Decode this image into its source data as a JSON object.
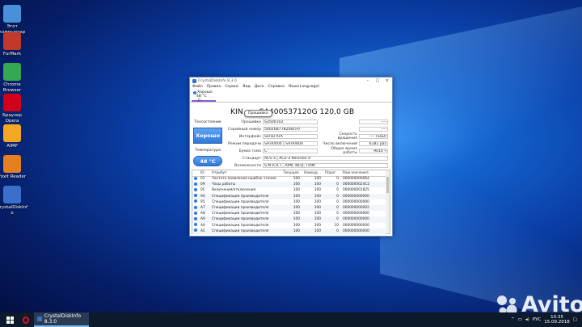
{
  "desktop": {
    "icons": [
      {
        "label": "Этот компьютер",
        "color": "#4a90d9"
      },
      {
        "label": "FurMark",
        "color": "#c0392b"
      },
      {
        "label": "Chrome Browser",
        "color": "#34a853"
      },
      {
        "label": "Браузер Opera",
        "color": "#d0021b"
      },
      {
        "label": "AIMP",
        "color": "#f5a623"
      },
      {
        "label": "Foxit Reader",
        "color": "#e67e22"
      },
      {
        "label": "CrystalDiskInf o",
        "color": "#3b6fc9"
      }
    ]
  },
  "window": {
    "title": "CrystalDiskInfo 8.3.0",
    "menu": [
      "Файл",
      "Правка",
      "Сервис",
      "Вид",
      "Диск",
      "Справка",
      "Язык(Language)"
    ],
    "disk_tab": {
      "status": "Хорошо",
      "temp": "48 °C",
      "letter": "C:"
    },
    "model": "KINGSTON SA400S37120G 120,0 GB",
    "model_visible_prefix": "KIN",
    "model_visible_suffix": "SA400S37120G 120,0 GB",
    "tooltip": "Прошивка",
    "health_label": "Техсостояние",
    "health_value": "Хорошо",
    "temp_label": "Температура",
    "temp_value": "48 °C",
    "info": [
      {
        "label": "Прошивка",
        "value": "S3500102"
      },
      {
        "label": "Серийный номер",
        "value": "50026B7782081F0"
      },
      {
        "label": "Интерфейс",
        "value": "Serial ATA"
      },
      {
        "label": "Режим передачи",
        "value": "SATA/600 | SATA/600"
      },
      {
        "label": "Буква тома",
        "value": "C:"
      }
    ],
    "info_right": [
      {
        "label": "",
        "value": "----"
      },
      {
        "label": "",
        "value": "----"
      },
      {
        "label": "Скорость вращения",
        "value": "---- (SSD)"
      },
      {
        "label": "Число включений",
        "value": "6181 раз"
      },
      {
        "label": "Общее время работы",
        "value": "9410 ч"
      }
    ],
    "standard": {
      "label": "Стандарт",
      "value": "ACS-3 | ACS-3 Revision 4"
    },
    "features": {
      "label": "Возможности",
      "value": "S.M.A.R.T., APM, NCQ, TRIM"
    },
    "smart_headers": [
      "ID",
      "Атрибут",
      "Текущее",
      "Наихуд...",
      "Порог",
      "Raw-значения"
    ],
    "smart_rows": [
      [
        "01",
        "Частота появления ошибок чтения",
        "100",
        "100",
        "0",
        "000000000064"
      ],
      [
        "09",
        "Часы работы",
        "100",
        "100",
        "0",
        "0000000024C2"
      ],
      [
        "0C",
        "Включения/отключения",
        "100",
        "100",
        "0",
        "000000001825"
      ],
      [
        "94",
        "Спецификации производителя",
        "100",
        "100",
        "0",
        "000000000000"
      ],
      [
        "95",
        "Спецификации производителя",
        "100",
        "100",
        "0",
        "000000000000"
      ],
      [
        "A7",
        "Спецификации производителя",
        "100",
        "100",
        "0",
        "000000000002"
      ],
      [
        "A8",
        "Спецификации производителя",
        "100",
        "100",
        "0",
        "000000000000"
      ],
      [
        "A9",
        "Спецификации производителя",
        "100",
        "100",
        "0",
        "000000000000"
      ],
      [
        "AA",
        "Спецификации производителя",
        "100",
        "100",
        "10",
        "000000000000"
      ],
      [
        "AC",
        "Спецификации производителя",
        "100",
        "100",
        "0",
        "000000000000"
      ]
    ]
  },
  "taskbar": {
    "task_label": "CrystalDiskInfo 8.3.0",
    "lang": "РУС",
    "time": "10:35",
    "date": "15.09.2018"
  },
  "watermark": "Avito"
}
